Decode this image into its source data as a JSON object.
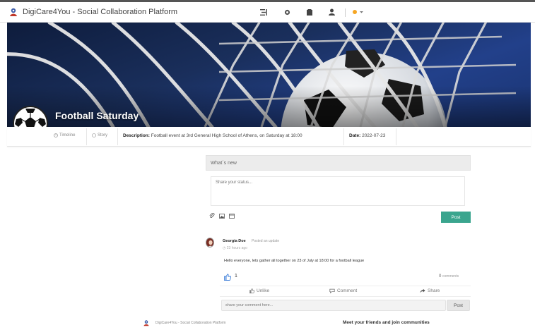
{
  "app": {
    "title": "DigiCare4You - Social Collaboration Platform"
  },
  "colors": {
    "accent": "#3aa58e",
    "notification": "#f5a623"
  },
  "topbar": {
    "icons": [
      "menu-lines-icon",
      "settings-icon",
      "box-icon",
      "user-icon",
      "notification-dot-icon"
    ]
  },
  "group": {
    "name": "Football Saturday",
    "tabs": {
      "timeline": "Timeline",
      "story": "Story"
    },
    "description_label": "Description:",
    "description": "Football event at 3rd General High School of Athens, on Saturday at 18:00",
    "date_label": "Date:",
    "date": "2022-07-23"
  },
  "status": {
    "header": "What´s new",
    "placeholder": "Share your status...",
    "post_label": "Post"
  },
  "post": {
    "author": "Georgia Doe",
    "action": "Posted an update",
    "time": "23 hours ago",
    "body": "Hello everyone, lets gather all together on 23 of July at 18:00 for a football league",
    "like_count": "1",
    "comment_count": "0",
    "comment_word": "comments",
    "actions": {
      "unlike": "Unlike",
      "comment": "Comment",
      "share": "Share"
    },
    "comment_placeholder": "share your comment here...",
    "comment_post_label": "Post"
  },
  "footer": {
    "text": "DigiCare4You - Social Collaboration Platform",
    "right": "Meet your friends and join communities"
  }
}
